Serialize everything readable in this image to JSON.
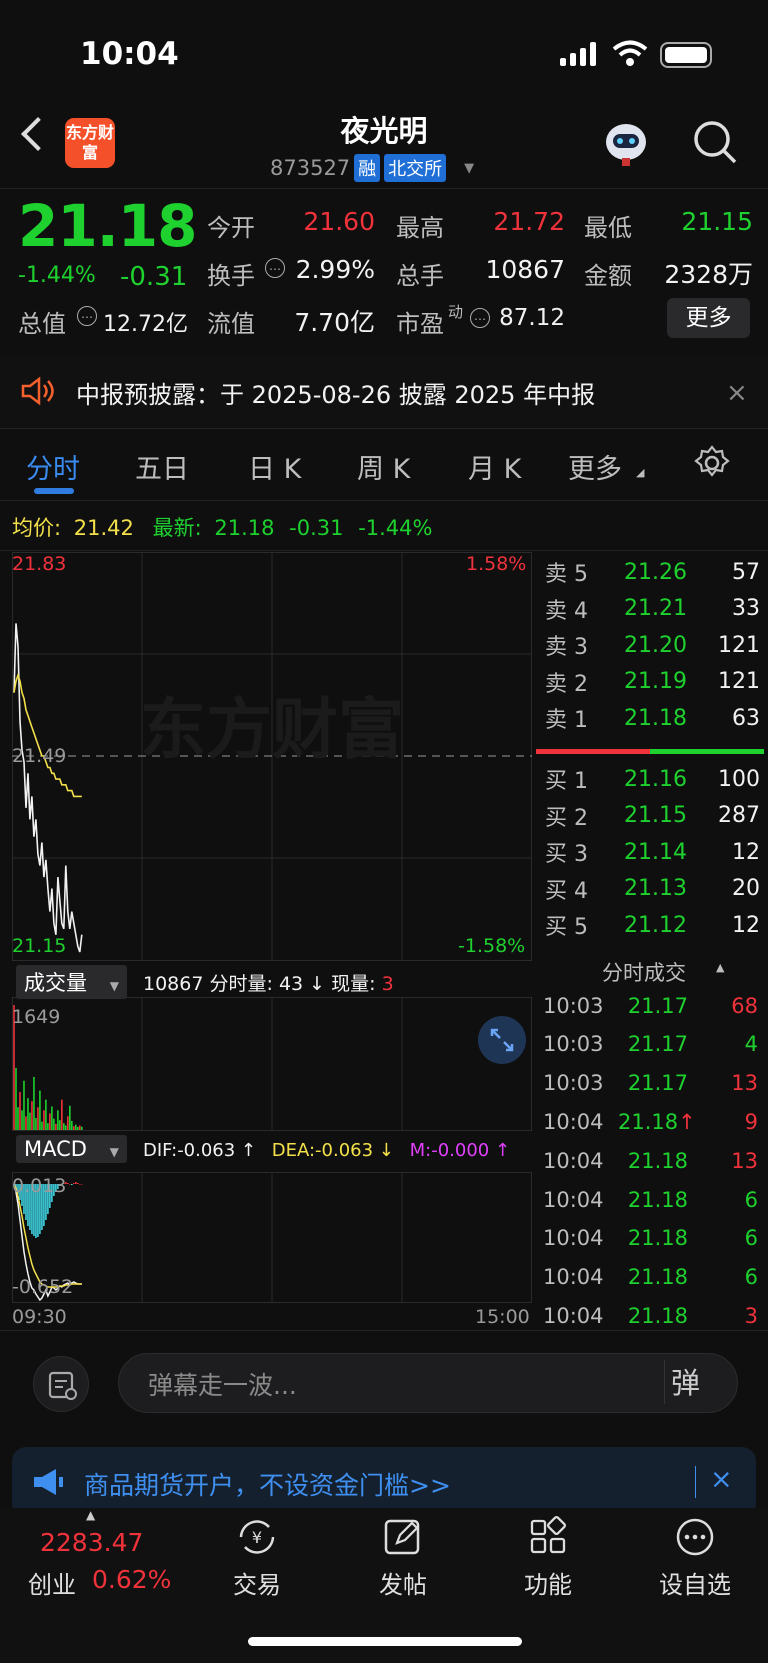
{
  "status_bar": {
    "time": "10:04"
  },
  "header": {
    "logo_text": "东方财富",
    "title": "夜光明",
    "code": "873527",
    "tag_margin": "融",
    "tag_exchange": "北交所"
  },
  "quote": {
    "price": "21.18",
    "change_pct": "-1.44%",
    "change_amt": "-0.31",
    "rows": [
      [
        {
          "label": "今开",
          "value": "21.60",
          "color": "red"
        },
        {
          "label": "最高",
          "value": "21.72",
          "color": "red"
        },
        {
          "label": "最低",
          "value": "21.15",
          "color": "green"
        }
      ],
      [
        {
          "label": "换手",
          "value": "2.99%",
          "color": "white"
        },
        {
          "label": "总手",
          "value": "10867",
          "color": "white"
        },
        {
          "label": "金额",
          "value": "2328万",
          "color": "white"
        }
      ],
      [
        {
          "label": "总值",
          "value": "12.72亿",
          "color": "white"
        },
        {
          "label": "流值",
          "value": "7.70亿",
          "color": "white"
        },
        {
          "label": "市盈",
          "value": "87.12",
          "color": "white"
        }
      ]
    ],
    "pe_superscript": "动",
    "more_label": "更多"
  },
  "notice": {
    "text": "中报预披露：于 2025-08-26 披露 2025 年中报",
    "close": "×"
  },
  "tabs": [
    "分时",
    "五日",
    "日 K",
    "周 K",
    "月 K",
    "更多"
  ],
  "active_tab": 0,
  "chart": {
    "avg_label": "均价:",
    "avg_value": "21.42",
    "latest_label": "最新:",
    "latest_value": "21.18",
    "latest_change": "-0.31",
    "latest_pct": "-1.44%",
    "y_top": "21.83",
    "y_mid": "21.49",
    "y_bot": "21.15",
    "pct_top": "1.58%",
    "pct_bot": "-1.58%",
    "watermark": "东方财富",
    "volume_pill": "成交量",
    "volume_info_total": "10867",
    "volume_info_label": "分时量: 43 ↓ 现量:",
    "volume_info_now": "3",
    "volume_max": "1649",
    "macd_pill": "MACD",
    "dif": "DIF:-0.063 ↑",
    "dea": "DEA:-0.063 ↓",
    "m": "M:-0.000 ↑",
    "macd_top": "0.013",
    "macd_bot": "-0.652",
    "time_start": "09:30",
    "time_end": "15:00"
  },
  "chart_data": {
    "type": "line",
    "x": [
      "09:30",
      "09:31",
      "09:32",
      "09:33",
      "09:34",
      "09:35",
      "09:36",
      "09:37",
      "09:38",
      "09:39",
      "09:40",
      "09:41",
      "09:42",
      "09:43",
      "09:44",
      "09:45",
      "09:46",
      "09:47",
      "09:48",
      "09:49",
      "09:50",
      "09:51",
      "09:52",
      "09:53",
      "09:54",
      "09:55",
      "09:56",
      "09:57",
      "09:58",
      "09:59",
      "10:00",
      "10:01",
      "10:02",
      "10:03",
      "10:04"
    ],
    "series": [
      {
        "values": [
          21.6,
          21.72,
          21.68,
          21.55,
          21.5,
          21.48,
          21.4,
          21.46,
          21.38,
          21.42,
          21.35,
          21.38,
          21.32,
          21.3,
          21.34,
          21.28,
          21.31,
          21.26,
          21.22,
          21.26,
          21.2,
          21.18,
          21.28,
          21.24,
          21.2,
          21.19,
          21.3,
          21.22,
          21.19,
          21.22,
          21.2,
          21.18,
          21.16,
          21.15,
          21.18
        ]
      },
      {
        "values": [
          21.6,
          21.62,
          21.63,
          21.62,
          21.6,
          21.59,
          21.57,
          21.56,
          21.55,
          21.54,
          21.53,
          21.52,
          21.51,
          21.5,
          21.49,
          21.49,
          21.48,
          21.47,
          21.47,
          21.46,
          21.46,
          21.45,
          21.45,
          21.45,
          21.44,
          21.44,
          21.44,
          21.43,
          21.43,
          21.43,
          21.42,
          21.42,
          21.42,
          21.42,
          21.42
        ]
      }
    ],
    "ylim": [
      21.15,
      21.83
    ]
  },
  "order_book": {
    "asks": [
      {
        "label": "卖 5",
        "price": "21.26",
        "qty": "57"
      },
      {
        "label": "卖 4",
        "price": "21.21",
        "qty": "33"
      },
      {
        "label": "卖 3",
        "price": "21.20",
        "qty": "121"
      },
      {
        "label": "卖 2",
        "price": "21.19",
        "qty": "121"
      },
      {
        "label": "卖 1",
        "price": "21.18",
        "qty": "63"
      }
    ],
    "bids": [
      {
        "label": "买 1",
        "price": "21.16",
        "qty": "100"
      },
      {
        "label": "买 2",
        "price": "21.15",
        "qty": "287"
      },
      {
        "label": "买 3",
        "price": "21.14",
        "qty": "12"
      },
      {
        "label": "买 4",
        "price": "21.13",
        "qty": "20"
      },
      {
        "label": "买 5",
        "price": "21.12",
        "qty": "12"
      }
    ]
  },
  "ticks": {
    "title": "分时成交",
    "rows": [
      {
        "time": "10:03",
        "price": "21.17",
        "qty": "68",
        "color": "red"
      },
      {
        "time": "10:03",
        "price": "21.17",
        "qty": "4",
        "color": "green"
      },
      {
        "time": "10:03",
        "price": "21.17",
        "qty": "13",
        "color": "red"
      },
      {
        "time": "10:04",
        "price": "21.18↑",
        "qty": "9",
        "color": "red"
      },
      {
        "time": "10:04",
        "price": "21.18",
        "qty": "13",
        "color": "red"
      },
      {
        "time": "10:04",
        "price": "21.18",
        "qty": "6",
        "color": "green"
      },
      {
        "time": "10:04",
        "price": "21.18",
        "qty": "6",
        "color": "green"
      },
      {
        "time": "10:04",
        "price": "21.18",
        "qty": "6",
        "color": "green"
      },
      {
        "time": "10:04",
        "price": "21.18",
        "qty": "3",
        "color": "red"
      }
    ]
  },
  "danmu": {
    "placeholder": "弹幕走一波...",
    "send": "弹"
  },
  "ad": {
    "text": "商品期货开户，不设资金门槛>>",
    "close": "×"
  },
  "bottom_nav": {
    "index_value": "2283.47",
    "index_name": "创业",
    "index_pct": "0.62%",
    "items": [
      "交易",
      "发帖",
      "功能",
      "设自选"
    ]
  },
  "colors": {
    "up": "#f0323b",
    "down": "#1ed12e",
    "accent": "#2f7de1",
    "background": "#0f0f10"
  }
}
